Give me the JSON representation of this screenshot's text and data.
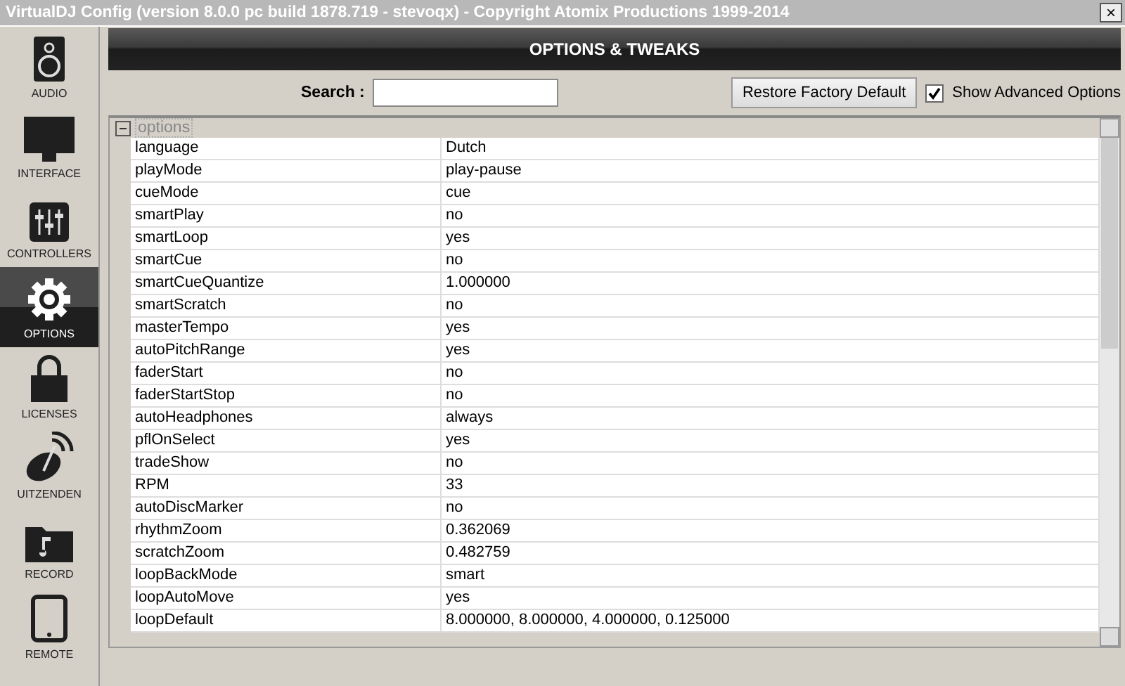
{
  "window": {
    "title": "VirtualDJ Config (version 8.0.0 pc build 1878.719 - stevoqx) - Copyright Atomix Productions 1999-2014",
    "close": "×"
  },
  "sidebar": {
    "items": [
      {
        "label": "AUDIO",
        "kind": "speaker",
        "selected": false
      },
      {
        "label": "INTERFACE",
        "kind": "monitor",
        "selected": false
      },
      {
        "label": "CONTROLLERS",
        "kind": "sliders",
        "selected": false
      },
      {
        "label": "OPTIONS",
        "kind": "gear",
        "selected": true
      },
      {
        "label": "LICENSES",
        "kind": "lock",
        "selected": false
      },
      {
        "label": "UITZENDEN",
        "kind": "broadcast",
        "selected": false
      },
      {
        "label": "RECORD",
        "kind": "folder",
        "selected": false
      },
      {
        "label": "REMOTE",
        "kind": "tablet",
        "selected": false
      }
    ]
  },
  "header": {
    "title": "OPTIONS & TWEAKS"
  },
  "toolbar": {
    "search_label": "Search :",
    "restore_button": "Restore Factory Default",
    "advanced": {
      "label": "Show Advanced Options",
      "checked": true
    }
  },
  "table": {
    "group": {
      "label": "options",
      "expanded": true
    },
    "rows": [
      {
        "name": "language",
        "value": "Dutch"
      },
      {
        "name": "playMode",
        "value": "play-pause"
      },
      {
        "name": "cueMode",
        "value": "cue"
      },
      {
        "name": "smartPlay",
        "value": "no"
      },
      {
        "name": "smartLoop",
        "value": "yes"
      },
      {
        "name": "smartCue",
        "value": "no"
      },
      {
        "name": "smartCueQuantize",
        "value": "1.000000"
      },
      {
        "name": "smartScratch",
        "value": "no"
      },
      {
        "name": "masterTempo",
        "value": "yes"
      },
      {
        "name": "autoPitchRange",
        "value": "yes"
      },
      {
        "name": "faderStart",
        "value": "no"
      },
      {
        "name": "faderStartStop",
        "value": "no"
      },
      {
        "name": "autoHeadphones",
        "value": "always"
      },
      {
        "name": "pflOnSelect",
        "value": "yes"
      },
      {
        "name": "tradeShow",
        "value": "no"
      },
      {
        "name": "RPM",
        "value": "33"
      },
      {
        "name": "autoDiscMarker",
        "value": "no"
      },
      {
        "name": "rhythmZoom",
        "value": "0.362069"
      },
      {
        "name": "scratchZoom",
        "value": "0.482759"
      },
      {
        "name": "loopBackMode",
        "value": "smart"
      },
      {
        "name": "loopAutoMove",
        "value": "yes"
      },
      {
        "name": "loopDefault",
        "value": "8.000000, 8.000000, 4.000000, 0.125000"
      }
    ]
  }
}
